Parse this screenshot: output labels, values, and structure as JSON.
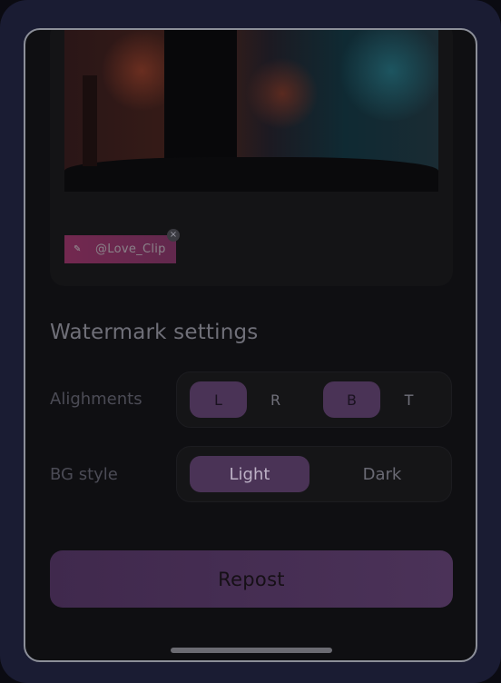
{
  "preview": {
    "watermark_text": "@Love_Clip"
  },
  "settings": {
    "title": "Watermark settings",
    "alignments_label": "Alighments",
    "align_h": [
      "L",
      "R"
    ],
    "align_v": [
      "B",
      "T"
    ],
    "bg_style_label": "BG style",
    "bg_options": [
      "Light",
      "Dark"
    ]
  },
  "actions": {
    "repost_label": "Repost"
  },
  "colors": {
    "accent": "#4a3356",
    "tag": "#c0397f",
    "background": "#0f0f12"
  }
}
